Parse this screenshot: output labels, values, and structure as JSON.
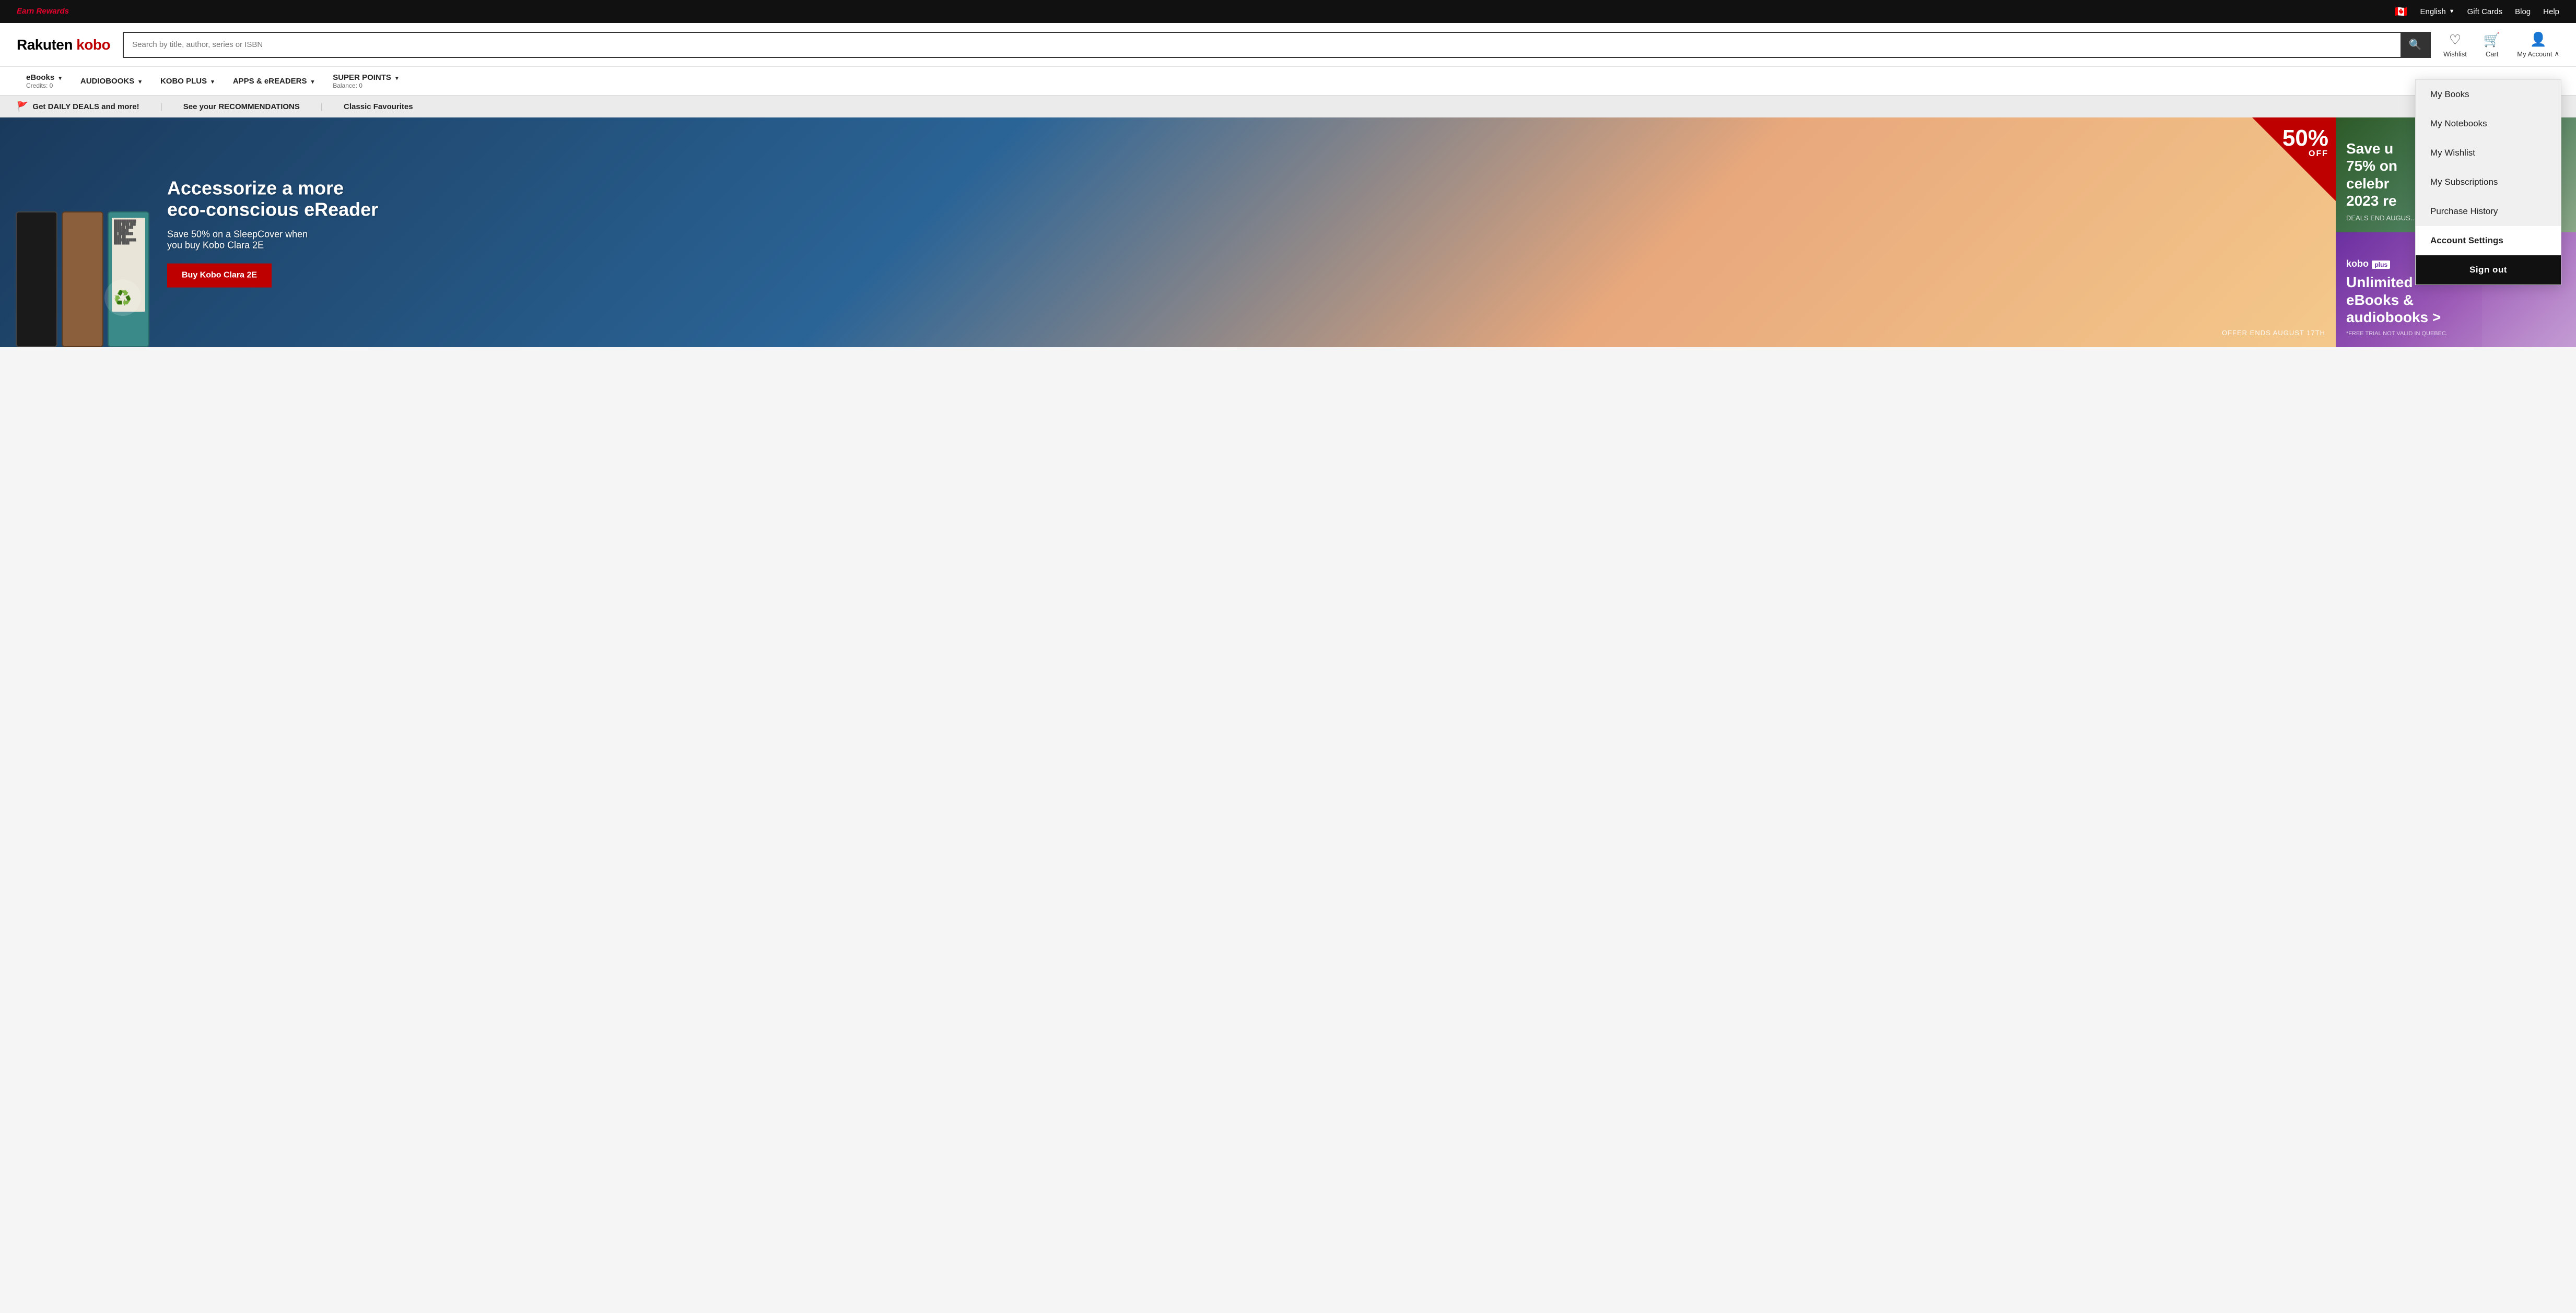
{
  "topBar": {
    "earnRewards": "Earn Rewards",
    "flag": "🇨🇦",
    "language": "English",
    "langChevron": "▼",
    "giftCards": "Gift Cards",
    "blog": "Blog",
    "help": "Help"
  },
  "header": {
    "logoLine1": "Rakuten",
    "logoLine2": "kobo",
    "searchPlaceholder": "Search by title, author, series or ISBN",
    "wishlistLabel": "Wishlist",
    "cartLabel": "Cart",
    "myAccountLabel": "My Account",
    "myAccountChevron": "∧"
  },
  "nav": {
    "items": [
      {
        "label": "eBOOKS",
        "sub": "Credits: 0",
        "chevron": true
      },
      {
        "label": "AUDIOBOOKS",
        "sub": "",
        "chevron": true
      },
      {
        "label": "KOBO PLUS",
        "sub": "",
        "chevron": true
      },
      {
        "label": "APPS & eREADERS",
        "sub": "",
        "chevron": true
      },
      {
        "label": "SUPER POINTS",
        "sub": "Balance: 0",
        "chevron": true
      }
    ]
  },
  "promoBar": {
    "items": [
      {
        "icon": "flag",
        "text": "Get DAILY DEALS and more!"
      },
      {
        "text": "See your RECOMMENDATIONS"
      },
      {
        "text": "Classic Favourites"
      }
    ]
  },
  "hero": {
    "badge50": "50%",
    "badgeOff": "OFF",
    "title": "Accessorize a more\neco-conscious eReader",
    "subtitle": "Save 50% on a SleepCover when\nyou buy Kobo Clara 2E",
    "ctaLabel": "Buy Kobo Clara 2E",
    "offerEnds": "OFFER ENDS AUGUST 17TH",
    "sideTop": {
      "line1": "Save u",
      "line2": "75% on",
      "line3": "celebr",
      "line4": "2023 re",
      "sub": "DEALS END AUGUS..."
    },
    "sideBottom": {
      "logoMain": "kobo",
      "logoSub": "plus",
      "title": "Unlimited\neBooks &\naudiobooks >",
      "sub": "*FREE TRIAL NOT VALID IN QUEBEC."
    }
  },
  "accountDropdown": {
    "items": [
      {
        "label": "My Books",
        "active": false
      },
      {
        "label": "My Notebooks",
        "active": false
      },
      {
        "label": "My Wishlist",
        "active": false
      },
      {
        "label": "My Subscriptions",
        "active": false
      },
      {
        "label": "Purchase History",
        "active": false
      },
      {
        "label": "Account Settings",
        "active": true
      }
    ],
    "signOut": "Sign out"
  }
}
